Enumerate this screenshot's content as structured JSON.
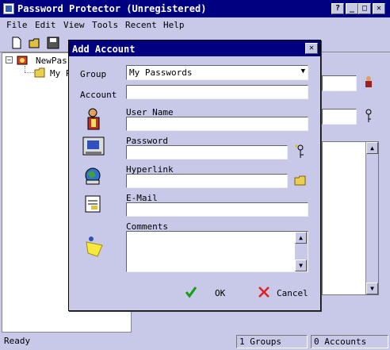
{
  "window": {
    "title": "Password Protector (Unregistered)"
  },
  "menu": [
    "File",
    "Edit",
    "View",
    "Tools",
    "Recent",
    "Help"
  ],
  "tree": {
    "root": "NewPass",
    "child": "My P"
  },
  "dialog": {
    "title": "Add Account",
    "group_label": "Group",
    "group_value": "My Passwords",
    "account_label": "Account",
    "username_label": "User Name",
    "password_label": "Password",
    "hyperlink_label": "Hyperlink",
    "email_label": "E-Mail",
    "comments_label": "Comments",
    "ok_label": "OK",
    "cancel_label": "Cancel"
  },
  "status": {
    "left": "Ready",
    "groups": "1 Groups",
    "accounts": "0 Accounts"
  },
  "colors": {
    "titlebar": "#000080",
    "face": "#c8c8e8"
  }
}
